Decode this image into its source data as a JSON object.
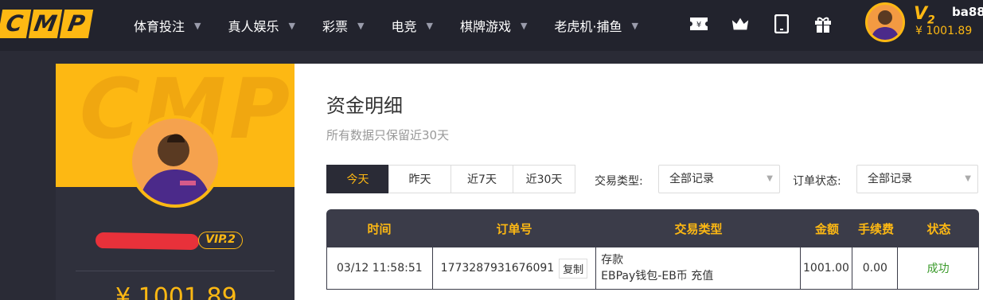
{
  "brand": {
    "letters": [
      "C",
      "M",
      "P"
    ],
    "color": "#fdb813"
  },
  "nav": {
    "items": [
      {
        "label": "体育投注"
      },
      {
        "label": "真人娱乐"
      },
      {
        "label": "彩票"
      },
      {
        "label": "电竞"
      },
      {
        "label": "棋牌游戏"
      },
      {
        "label": "老虎机·捕鱼"
      }
    ],
    "icons": [
      "ticket-icon",
      "crown-icon",
      "tablet-icon",
      "gift-icon"
    ]
  },
  "user": {
    "vip_level_top": "V",
    "vip_level_num": "2",
    "name": "ba88",
    "balance": "¥ 1001.89",
    "vip_badge": "VIP.2",
    "panel_balance": "¥ 1001.89"
  },
  "page": {
    "title": "资金明细",
    "subtitle": "所有数据只保留近30天",
    "date_tabs": [
      "今天",
      "昨天",
      "近7天",
      "近30天"
    ],
    "active_tab": "今天",
    "type_filter_label": "交易类型:",
    "type_filter_value": "全部记录",
    "status_filter_label": "订单状态:",
    "status_filter_value": "全部记录"
  },
  "table": {
    "headers": [
      "时间",
      "订单号",
      "交易类型",
      "金额",
      "手续费",
      "状态"
    ],
    "rows": [
      {
        "time": "03/12 11:58:51",
        "order_no": "1773287931676091",
        "copy_label": "复制",
        "type_line1": "存款",
        "type_line2": "EBPay钱包-EB币 充值",
        "amount": "1001.00",
        "fee": "0.00",
        "status": "成功"
      }
    ]
  },
  "colors": {
    "accent": "#fdb813",
    "dark": "#2a2b36",
    "success": "#3a9a2a",
    "redact": "#e8313a"
  }
}
